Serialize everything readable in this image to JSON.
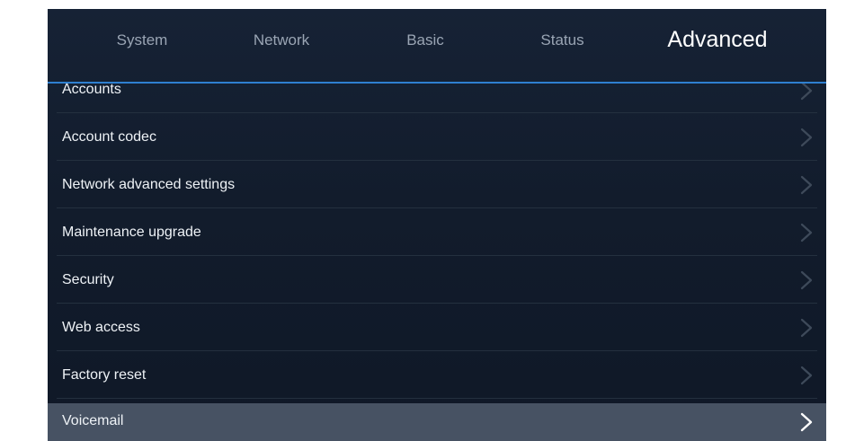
{
  "tabs": [
    {
      "label": "System",
      "active": false
    },
    {
      "label": "Network",
      "active": false
    },
    {
      "label": "Basic",
      "active": false
    },
    {
      "label": "Status",
      "active": false
    },
    {
      "label": "Advanced",
      "active": true
    }
  ],
  "menu": {
    "items": [
      {
        "label": "Accounts",
        "selected": false
      },
      {
        "label": "Account codec",
        "selected": false
      },
      {
        "label": "Network advanced settings",
        "selected": false
      },
      {
        "label": "Maintenance upgrade",
        "selected": false
      },
      {
        "label": "Security",
        "selected": false
      },
      {
        "label": "Web access",
        "selected": false
      },
      {
        "label": "Factory reset",
        "selected": false
      },
      {
        "label": "Voicemail",
        "selected": true
      }
    ]
  },
  "colors": {
    "background": "#121c2c",
    "accent_line": "#2f80d0",
    "selected_row": "#475263",
    "text": "#eef2f6",
    "inactive_tab": "#9aa5b4"
  },
  "icons": {
    "row_chevron": "chevron-right-icon"
  }
}
